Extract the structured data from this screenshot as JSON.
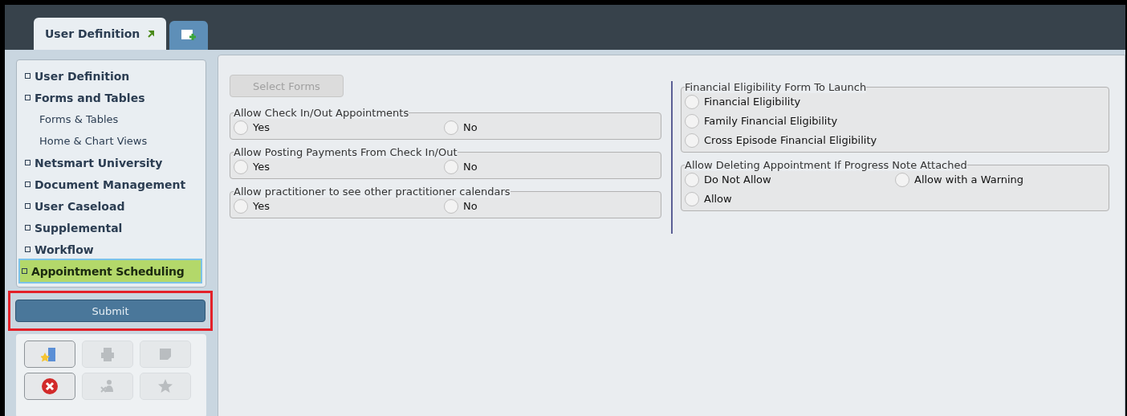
{
  "tabs": [
    {
      "label": "User Definition",
      "kind": "text",
      "selected": true
    },
    {
      "kind": "add",
      "selected": false
    }
  ],
  "sidebar": {
    "items": [
      {
        "label": "User Definition",
        "kind": "section",
        "selected": false
      },
      {
        "label": "Forms and Tables",
        "kind": "section",
        "selected": false
      },
      {
        "label": "Forms & Tables",
        "kind": "sub",
        "selected": false
      },
      {
        "label": "Home & Chart Views",
        "kind": "sub",
        "selected": false
      },
      {
        "label": "Netsmart University",
        "kind": "section",
        "selected": false
      },
      {
        "label": "Document Management",
        "kind": "section",
        "selected": false
      },
      {
        "label": "User Caseload",
        "kind": "section",
        "selected": false
      },
      {
        "label": "Supplemental",
        "kind": "section",
        "selected": false
      },
      {
        "label": "Workflow",
        "kind": "section",
        "selected": false
      },
      {
        "label": "Appointment Scheduling",
        "kind": "section",
        "selected": true
      }
    ],
    "submit": {
      "label": "Submit",
      "highlighted": true
    },
    "tool_buttons": [
      {
        "kind": "open",
        "disabled": false
      },
      {
        "kind": "print",
        "disabled": true
      },
      {
        "kind": "note",
        "disabled": true
      },
      {
        "kind": "delete",
        "disabled": false
      },
      {
        "kind": "people",
        "disabled": true
      },
      {
        "kind": "star",
        "disabled": true
      }
    ]
  },
  "select_forms": {
    "label": "Select Forms",
    "disabled": true
  },
  "left_groups": [
    {
      "title": "Allow Check In/Out Appointments",
      "rows": [
        [
          {
            "label": "Yes",
            "selected": false
          },
          {
            "label": "No",
            "selected": false
          }
        ]
      ]
    },
    {
      "title": "Allow Posting Payments From Check In/Out",
      "rows": [
        [
          {
            "label": "Yes",
            "selected": false
          },
          {
            "label": "No",
            "selected": false
          }
        ]
      ]
    },
    {
      "title": "Allow practitioner to see other practitioner calendars",
      "rows": [
        [
          {
            "label": "Yes",
            "selected": false
          },
          {
            "label": "No",
            "selected": false
          }
        ]
      ]
    }
  ],
  "right_groups": [
    {
      "title": "Financial Eligibility Form To Launch",
      "rows": [
        [
          {
            "label": "Financial Eligibility",
            "selected": false
          }
        ],
        [
          {
            "label": "Family Financial Eligibility",
            "selected": false
          }
        ],
        [
          {
            "label": "Cross Episode Financial Eligibility",
            "selected": false
          }
        ]
      ]
    },
    {
      "title": "Allow Deleting Appointment If Progress Note Attached",
      "rows": [
        [
          {
            "label": "Do Not Allow",
            "selected": false
          },
          {
            "label": "Allow with a Warning",
            "selected": false
          }
        ],
        [
          {
            "label": "Allow",
            "selected": false
          }
        ]
      ]
    }
  ]
}
